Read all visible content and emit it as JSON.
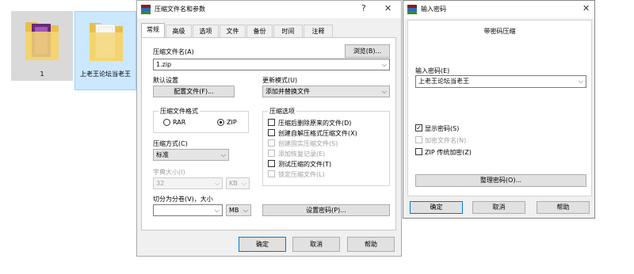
{
  "desktop": {
    "folders": [
      {
        "label": "1",
        "selected": false
      },
      {
        "label": "上老王论坛当老王",
        "selected": true
      }
    ]
  },
  "archive_dialog": {
    "title": "压缩文件名和参数",
    "help_glyph": "?",
    "close_glyph": "✕",
    "tabs": [
      "常规",
      "高级",
      "选项",
      "文件",
      "备份",
      "时间",
      "注释"
    ],
    "archive_name_label": "压缩文件名(A)",
    "browse_button": "浏览(B)...",
    "archive_name_value": "1.zip",
    "default_settings_label": "默认设置",
    "profiles_button": "配置文件(F)...",
    "update_mode_label": "更新模式(U)",
    "update_mode_value": "添加并替换文件",
    "format_group_title": "压缩文件格式",
    "format_options": [
      {
        "label": "RAR",
        "checked": false
      },
      {
        "label": "ZIP",
        "checked": true
      }
    ],
    "options_group_title": "压缩选项",
    "options": [
      {
        "label": "压缩后删除原来的文件(D)",
        "checked": false,
        "enabled": true
      },
      {
        "label": "创建自解压格式压缩文件(X)",
        "checked": false,
        "enabled": true
      },
      {
        "label": "创建固实压缩文件(S)",
        "checked": false,
        "enabled": false
      },
      {
        "label": "添加恢复记录(E)",
        "checked": false,
        "enabled": false
      },
      {
        "label": "测试压缩的文件(T)",
        "checked": false,
        "enabled": true
      },
      {
        "label": "锁定压缩文件(L)",
        "checked": false,
        "enabled": false
      }
    ],
    "method_label": "压缩方式(C)",
    "method_value": "标准",
    "dict_label": "字典大小(I)",
    "dict_value": "32",
    "dict_unit": "KB",
    "split_label": "切分为分卷(V)，大小",
    "split_value": "",
    "split_unit": "MB",
    "set_password_button": "设置密码(P)...",
    "ok_button": "确定",
    "cancel_button": "取消",
    "help_button": "帮助"
  },
  "password_dialog": {
    "title": "输入密码",
    "close_glyph": "✕",
    "heading": "带密码压缩",
    "password_label": "输入密码(E)",
    "password_value": "上老王论坛当老王",
    "checkboxes": [
      {
        "label": "显示密码(S)",
        "checked": true,
        "enabled": true
      },
      {
        "label": "加密文件名(N)",
        "checked": false,
        "enabled": false
      },
      {
        "label": "ZIP 传统加密(Z)",
        "checked": false,
        "enabled": true
      }
    ],
    "organize_button": "整理密码(O)...",
    "ok_button": "确定",
    "cancel_button": "取消",
    "help_button": "帮助"
  },
  "colors": {
    "selection": "#cce8ff",
    "folder": "#f5d776",
    "folder_dark": "#e6bf4e",
    "purple": "#7b3a8f"
  }
}
